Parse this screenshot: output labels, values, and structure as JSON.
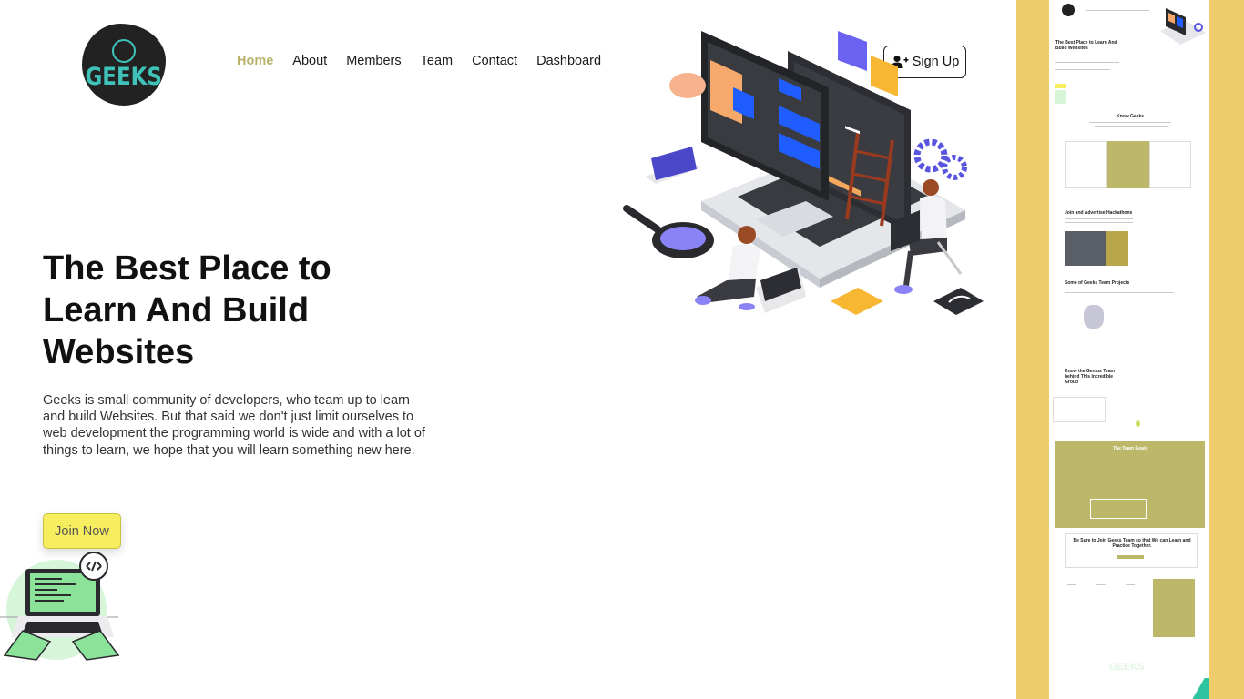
{
  "header": {
    "logo_text": "GEEKS",
    "nav": [
      {
        "label": "Home",
        "active": true
      },
      {
        "label": "About",
        "active": false
      },
      {
        "label": "Members",
        "active": false
      },
      {
        "label": "Team",
        "active": false
      },
      {
        "label": "Contact",
        "active": false
      },
      {
        "label": "Dashboard",
        "active": false
      }
    ],
    "signup_label": "Sign Up",
    "signup_icon": "user-plus-icon"
  },
  "hero": {
    "title": "The Best Place to Learn And Build Websites",
    "description": "Geeks is small community of developers, who team up to learn and build Websites. But that said we don't just limit ourselves to web development the programming world is wide and with a lot of things to learn, we hope that you will learn something new here.",
    "join_label": "Join Now",
    "illustration": "developers-laptop-illustration",
    "small_illustration": "coder-laptop-illustration"
  },
  "preview": {
    "hero_title": "The Best Place to Learn And Build Websites",
    "know_title": "Know Geeks",
    "hackathon_title": "Join and Advertise Hackathons",
    "projects_title": "Some of Geeks Team Projects",
    "team_title": "Know the Genius Team behind This Incredible Group",
    "goals_title": "The Team Goals",
    "cta_title": "Be Sure to Join Geeks Team so that We can Learn and Practice Together.",
    "footer_logo": "GEEKS"
  },
  "colors": {
    "accent": "#b9b36a",
    "join_button": "#f7ee5f",
    "preview_bg": "#efcc6c",
    "logo_teal": "#3fc3b9"
  }
}
